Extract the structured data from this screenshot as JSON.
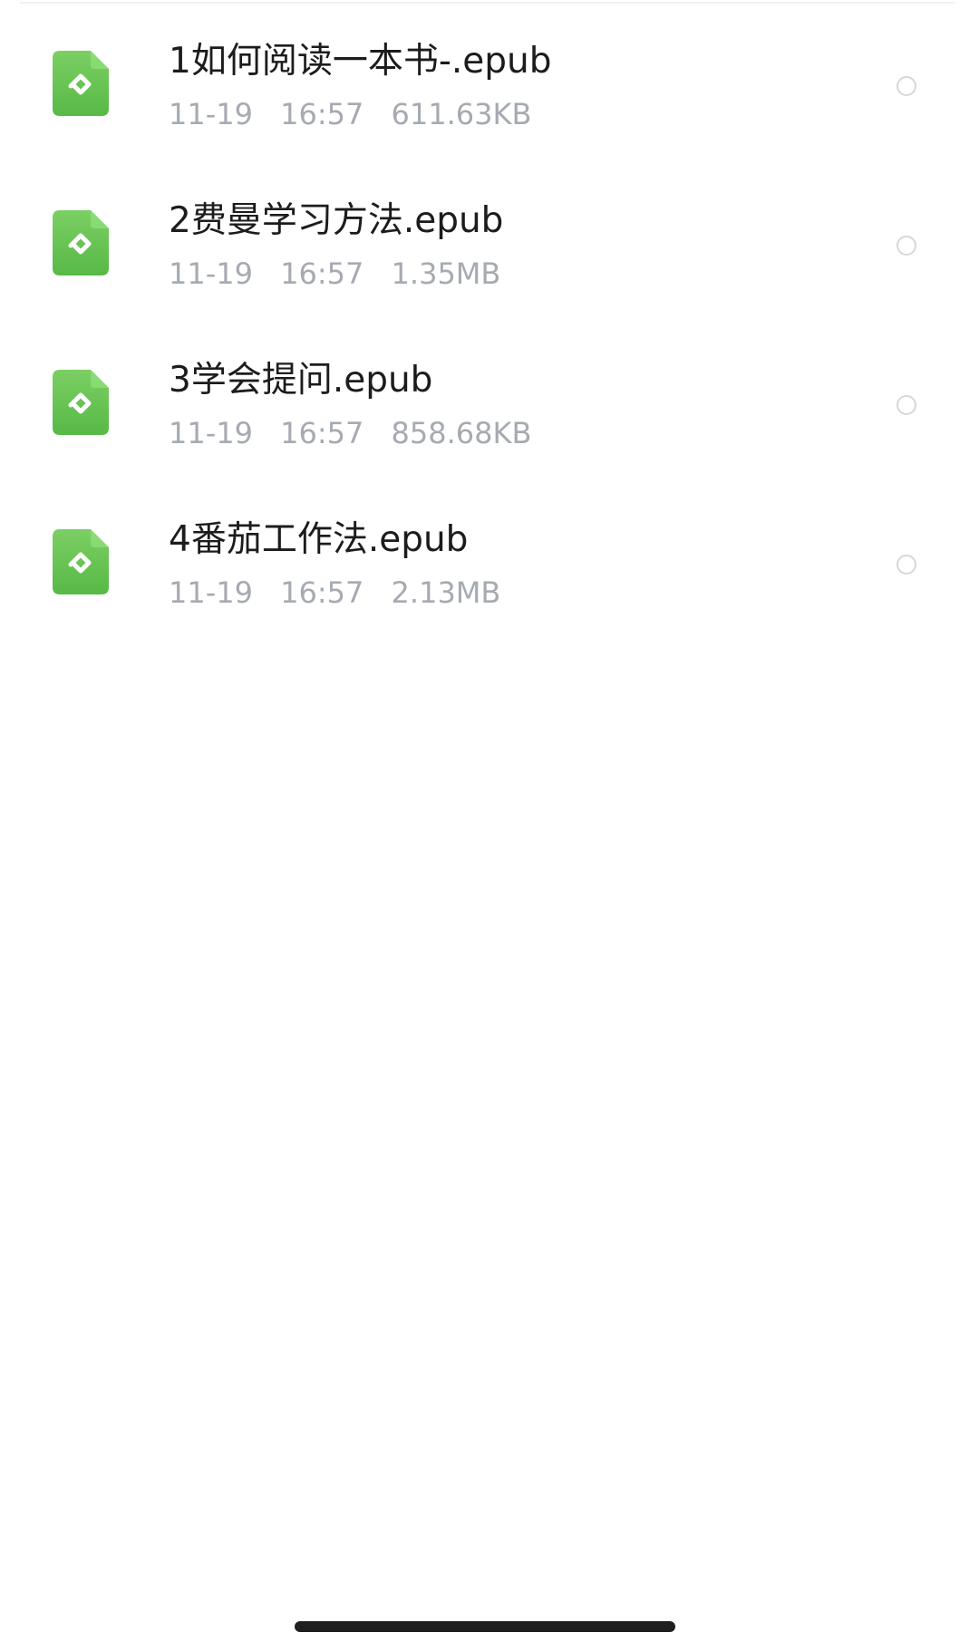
{
  "files": [
    {
      "name": "1如何阅读一本书-.epub",
      "date": "11-19",
      "time": "16:57",
      "size": "611.63KB",
      "icon": "epub-file-icon"
    },
    {
      "name": "2费曼学习方法.epub",
      "date": "11-19",
      "time": "16:57",
      "size": "1.35MB",
      "icon": "epub-file-icon"
    },
    {
      "name": "3学会提问.epub",
      "date": "11-19",
      "time": "16:57",
      "size": "858.68KB",
      "icon": "epub-file-icon"
    },
    {
      "name": "4番茄工作法.epub",
      "date": "11-19",
      "time": "16:57",
      "size": "2.13MB",
      "icon": "epub-file-icon"
    }
  ],
  "colors": {
    "icon_green_light": "#7ccf63",
    "icon_green_dark": "#57b946",
    "meta_gray": "#a6aab1",
    "title_text": "#1c1c1c"
  }
}
